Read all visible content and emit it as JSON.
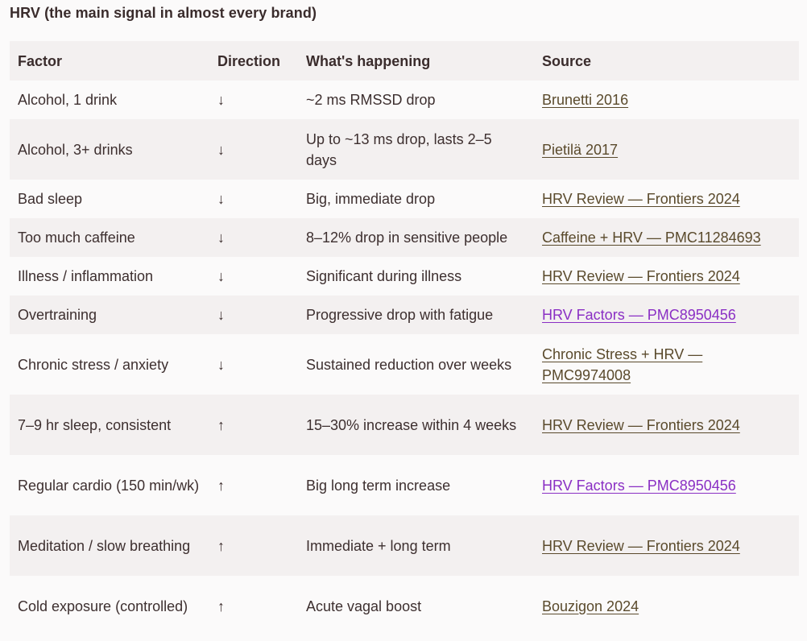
{
  "heading": "HRV (the main signal in almost every brand)",
  "table": {
    "headers": [
      "Factor",
      "Direction",
      "What's happening",
      "Source"
    ],
    "rows": [
      {
        "factor": "Alcohol, 1 drink",
        "direction": "↓",
        "effect": "~2 ms RMSSD drop",
        "source": "Brunetti 2016",
        "visited": false
      },
      {
        "factor": "Alcohol, 3+ drinks",
        "direction": "↓",
        "effect": "Up to ~13 ms drop, lasts 2–5 days",
        "source": "Pietilä 2017",
        "visited": false
      },
      {
        "factor": "Bad sleep",
        "direction": "↓",
        "effect": "Big, immediate drop",
        "source": "HRV Review — Frontiers 2024",
        "visited": false
      },
      {
        "factor": "Too much caffeine",
        "direction": "↓",
        "effect": "8–12% drop in sensitive people",
        "source": "Caffeine + HRV — PMC11284693",
        "visited": false
      },
      {
        "factor": "Illness / inflammation",
        "direction": "↓",
        "effect": "Significant during illness",
        "source": "HRV Review — Frontiers 2024",
        "visited": false
      },
      {
        "factor": "Overtraining",
        "direction": "↓",
        "effect": "Progressive drop with fatigue",
        "source": "HRV Factors — PMC8950456",
        "visited": true
      },
      {
        "factor": "Chronic stress / anxiety",
        "direction": "↓",
        "effect": "Sustained reduction over weeks",
        "source": "Chronic Stress + HRV — PMC9974008",
        "visited": false
      },
      {
        "factor": "7–9 hr sleep, consistent",
        "direction": "↑",
        "effect": "15–30% increase within 4 weeks",
        "source": "HRV Review — Frontiers 2024",
        "visited": false
      },
      {
        "factor": "Regular cardio (150 min/wk)",
        "direction": "↑",
        "effect": "Big long term increase",
        "source": "HRV Factors — PMC8950456",
        "visited": true
      },
      {
        "factor": "Meditation / slow breathing",
        "direction": "↑",
        "effect": "Immediate + long term",
        "source": "HRV Review — Frontiers 2024",
        "visited": false
      },
      {
        "factor": "Cold exposure (controlled)",
        "direction": "↑",
        "effect": "Acute vagal boost",
        "source": "Bouzigon 2024",
        "visited": false
      }
    ]
  },
  "colors": {
    "text": "#3d2f2f",
    "link": "#5a4a2c",
    "visited_link": "#8a2fc4",
    "row_alt": "#f3f0f0",
    "background": "#fbfafa"
  }
}
